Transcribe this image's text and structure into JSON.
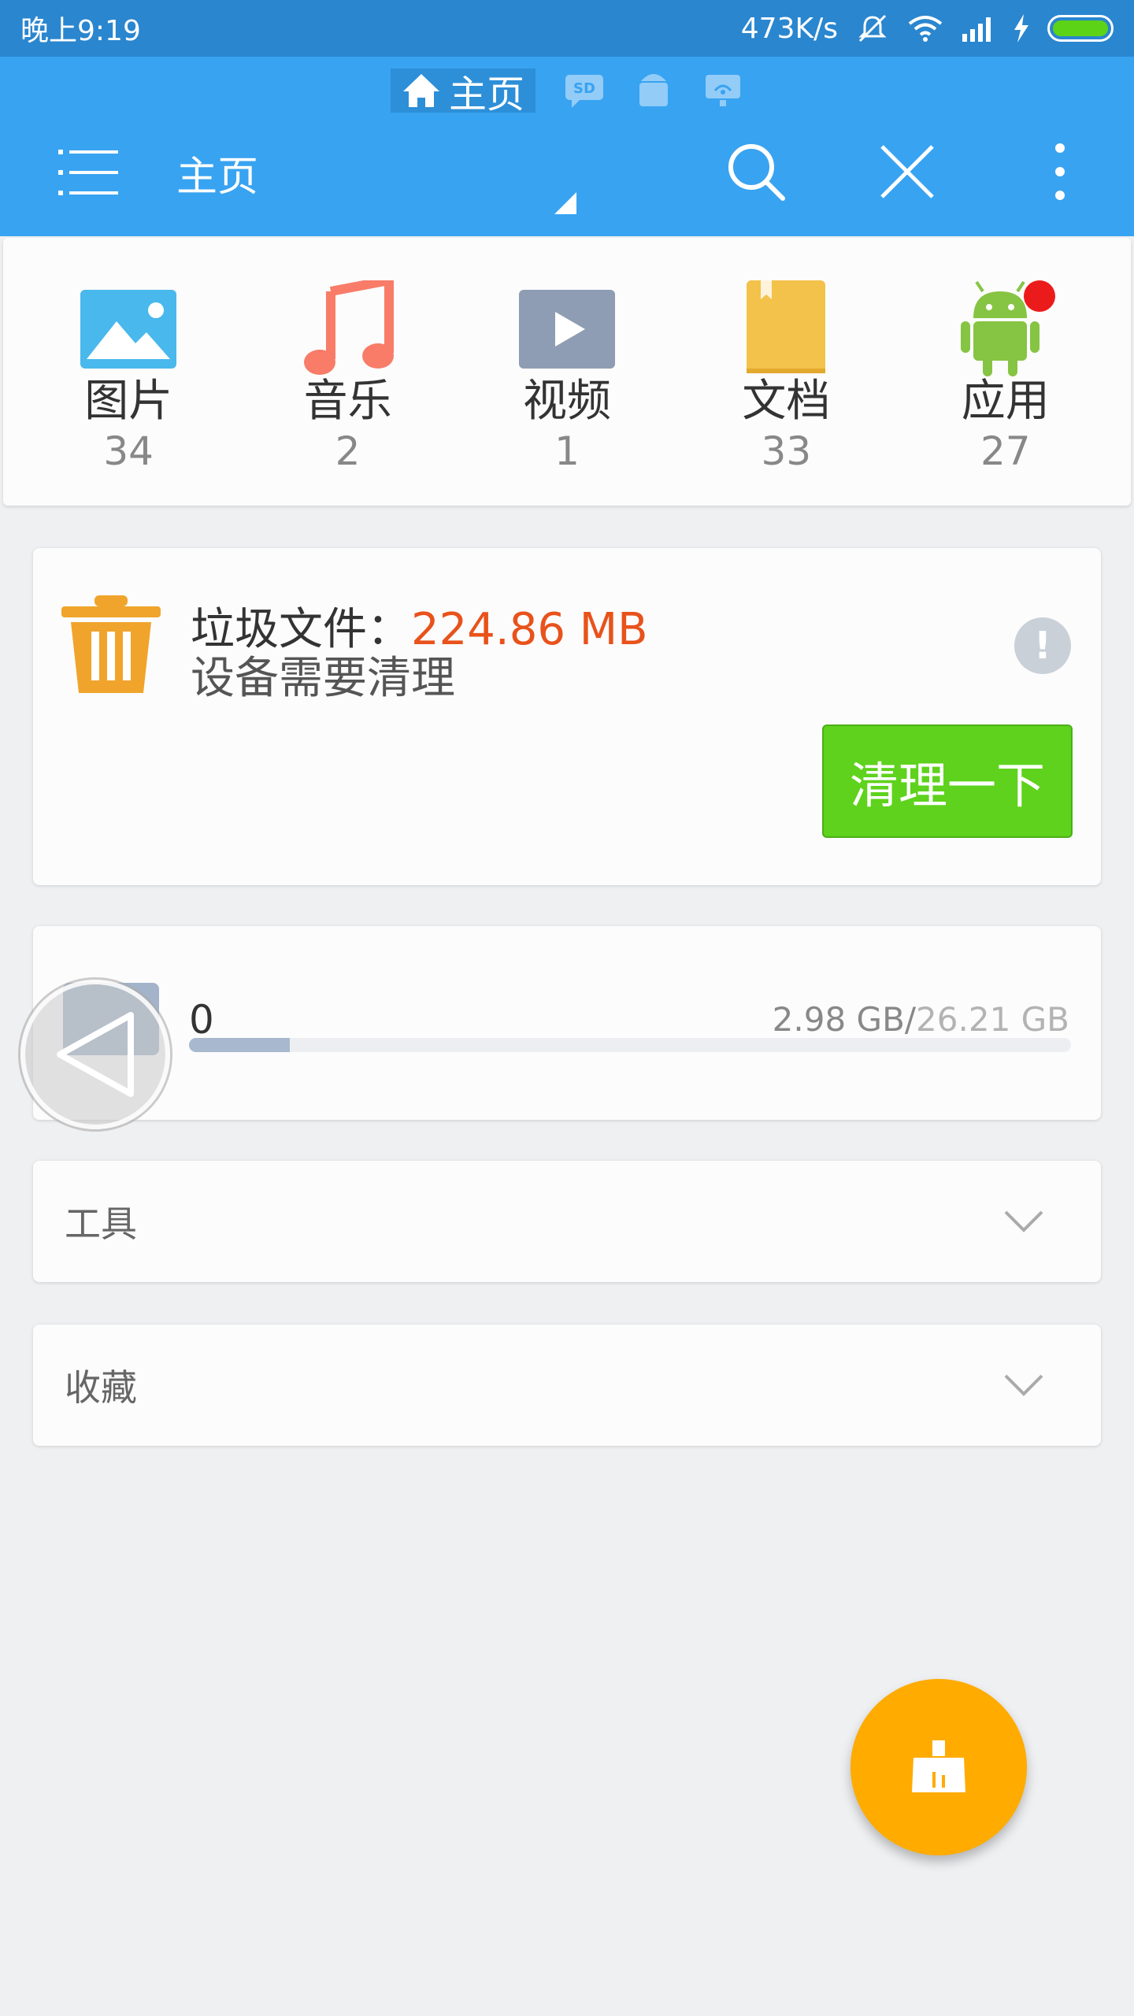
{
  "status_bar": {
    "time": "晚上9:19",
    "network_speed": "473K/s",
    "battery_color": "#5dd317"
  },
  "toolbar": {
    "active_tab": "主页",
    "title": "主页",
    "icons": [
      "menu-icon",
      "search-icon",
      "close-icon",
      "more-vert-icon"
    ]
  },
  "categories": [
    {
      "label": "图片",
      "count": "34",
      "icon": "image-icon",
      "color": "#49b8ec"
    },
    {
      "label": "音乐",
      "count": "2",
      "icon": "music-note-icon",
      "color": "#f87c68"
    },
    {
      "label": "视频",
      "count": "1",
      "icon": "video-icon",
      "color": "#8e9db3"
    },
    {
      "label": "文档",
      "count": "33",
      "icon": "document-icon",
      "color": "#f3c24a"
    },
    {
      "label": "应用",
      "count": "27",
      "icon": "android-icon",
      "color": "#86c443"
    }
  ],
  "junk": {
    "label": "垃圾文件：",
    "size": "224.86 MB",
    "message": "设备需要清理",
    "info_badge": "!",
    "clean_button": "清理一下"
  },
  "storage": {
    "name": "0",
    "used": "2.98 GB/",
    "total": "26.21 GB",
    "used_fraction": 0.114
  },
  "sections": {
    "tools": "工具",
    "favorites": "收藏"
  },
  "colors": {
    "app_bar": "#38a3f1",
    "status_bar": "#2a86cf",
    "accent_orange": "#ffab00",
    "clean_green": "#5ed21c",
    "junk_size_red": "#e8521b"
  }
}
